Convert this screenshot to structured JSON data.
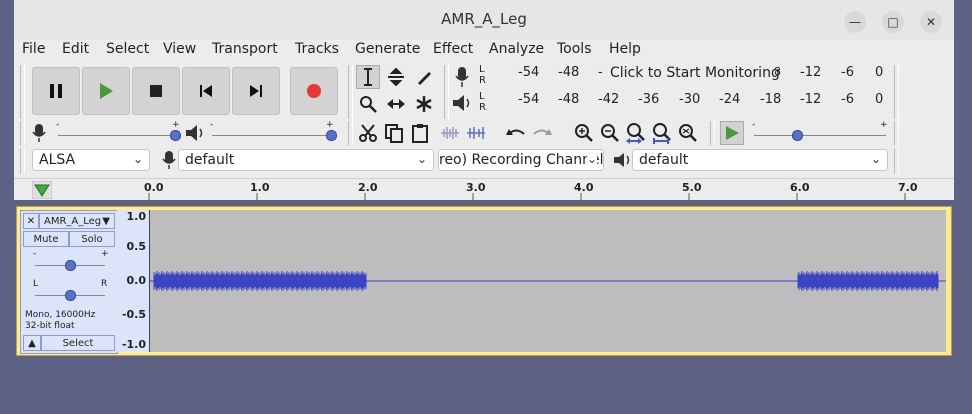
{
  "window": {
    "title": "AMR_A_Leg"
  },
  "menu": [
    "File",
    "Edit",
    "Select",
    "View",
    "Transport",
    "Tracks",
    "Generate",
    "Effect",
    "Analyze",
    "Tools",
    "Help"
  ],
  "transport": {
    "pause": "pause-icon",
    "play": "play-icon",
    "stop": "stop-icon",
    "skip_start": "skip-to-start-icon",
    "skip_end": "skip-to-end-icon",
    "record": "record-icon",
    "colors": {
      "play": "#4a9a3a",
      "record": "#e53935"
    }
  },
  "meters": {
    "record_scale": [
      "-54",
      "-48",
      "-12",
      "-6",
      "0"
    ],
    "record_prompt": "Click to Start Monitoring",
    "record_clip": "8",
    "playback_scale": [
      "-54",
      "-48",
      "-42",
      "-36",
      "-30",
      "-24",
      "-18",
      "-12",
      "-6",
      "0"
    ],
    "lr": [
      "L",
      "R"
    ]
  },
  "mixer": {
    "rec_plus": "+",
    "rec_minus": "-",
    "play_plus": "+",
    "play_minus": "-"
  },
  "playspeed": {
    "minus": "-",
    "plus": "+"
  },
  "device": {
    "host": "ALSA",
    "recording_device": "default",
    "channels": "reo) Recording Channels",
    "playback_device": "default"
  },
  "ruler": {
    "ticks": [
      "0.0",
      "1.0",
      "2.0",
      "3.0",
      "4.0",
      "5.0",
      "6.0",
      "7.0"
    ]
  },
  "track": {
    "name": "AMR_A_Leg",
    "mute": "Mute",
    "solo": "Solo",
    "gain_minus": "-",
    "gain_plus": "+",
    "pan_left": "L",
    "pan_right": "R",
    "format_line1": "Mono, 16000Hz",
    "format_line2": "32-bit float",
    "select": "Select",
    "scale": [
      "1.0",
      "0.5",
      "0.0",
      "-0.5",
      "-1.0"
    ],
    "colors": {
      "wave": "#3b44c4",
      "background": "#bdbdbd",
      "frame": "#ffec8e"
    }
  }
}
